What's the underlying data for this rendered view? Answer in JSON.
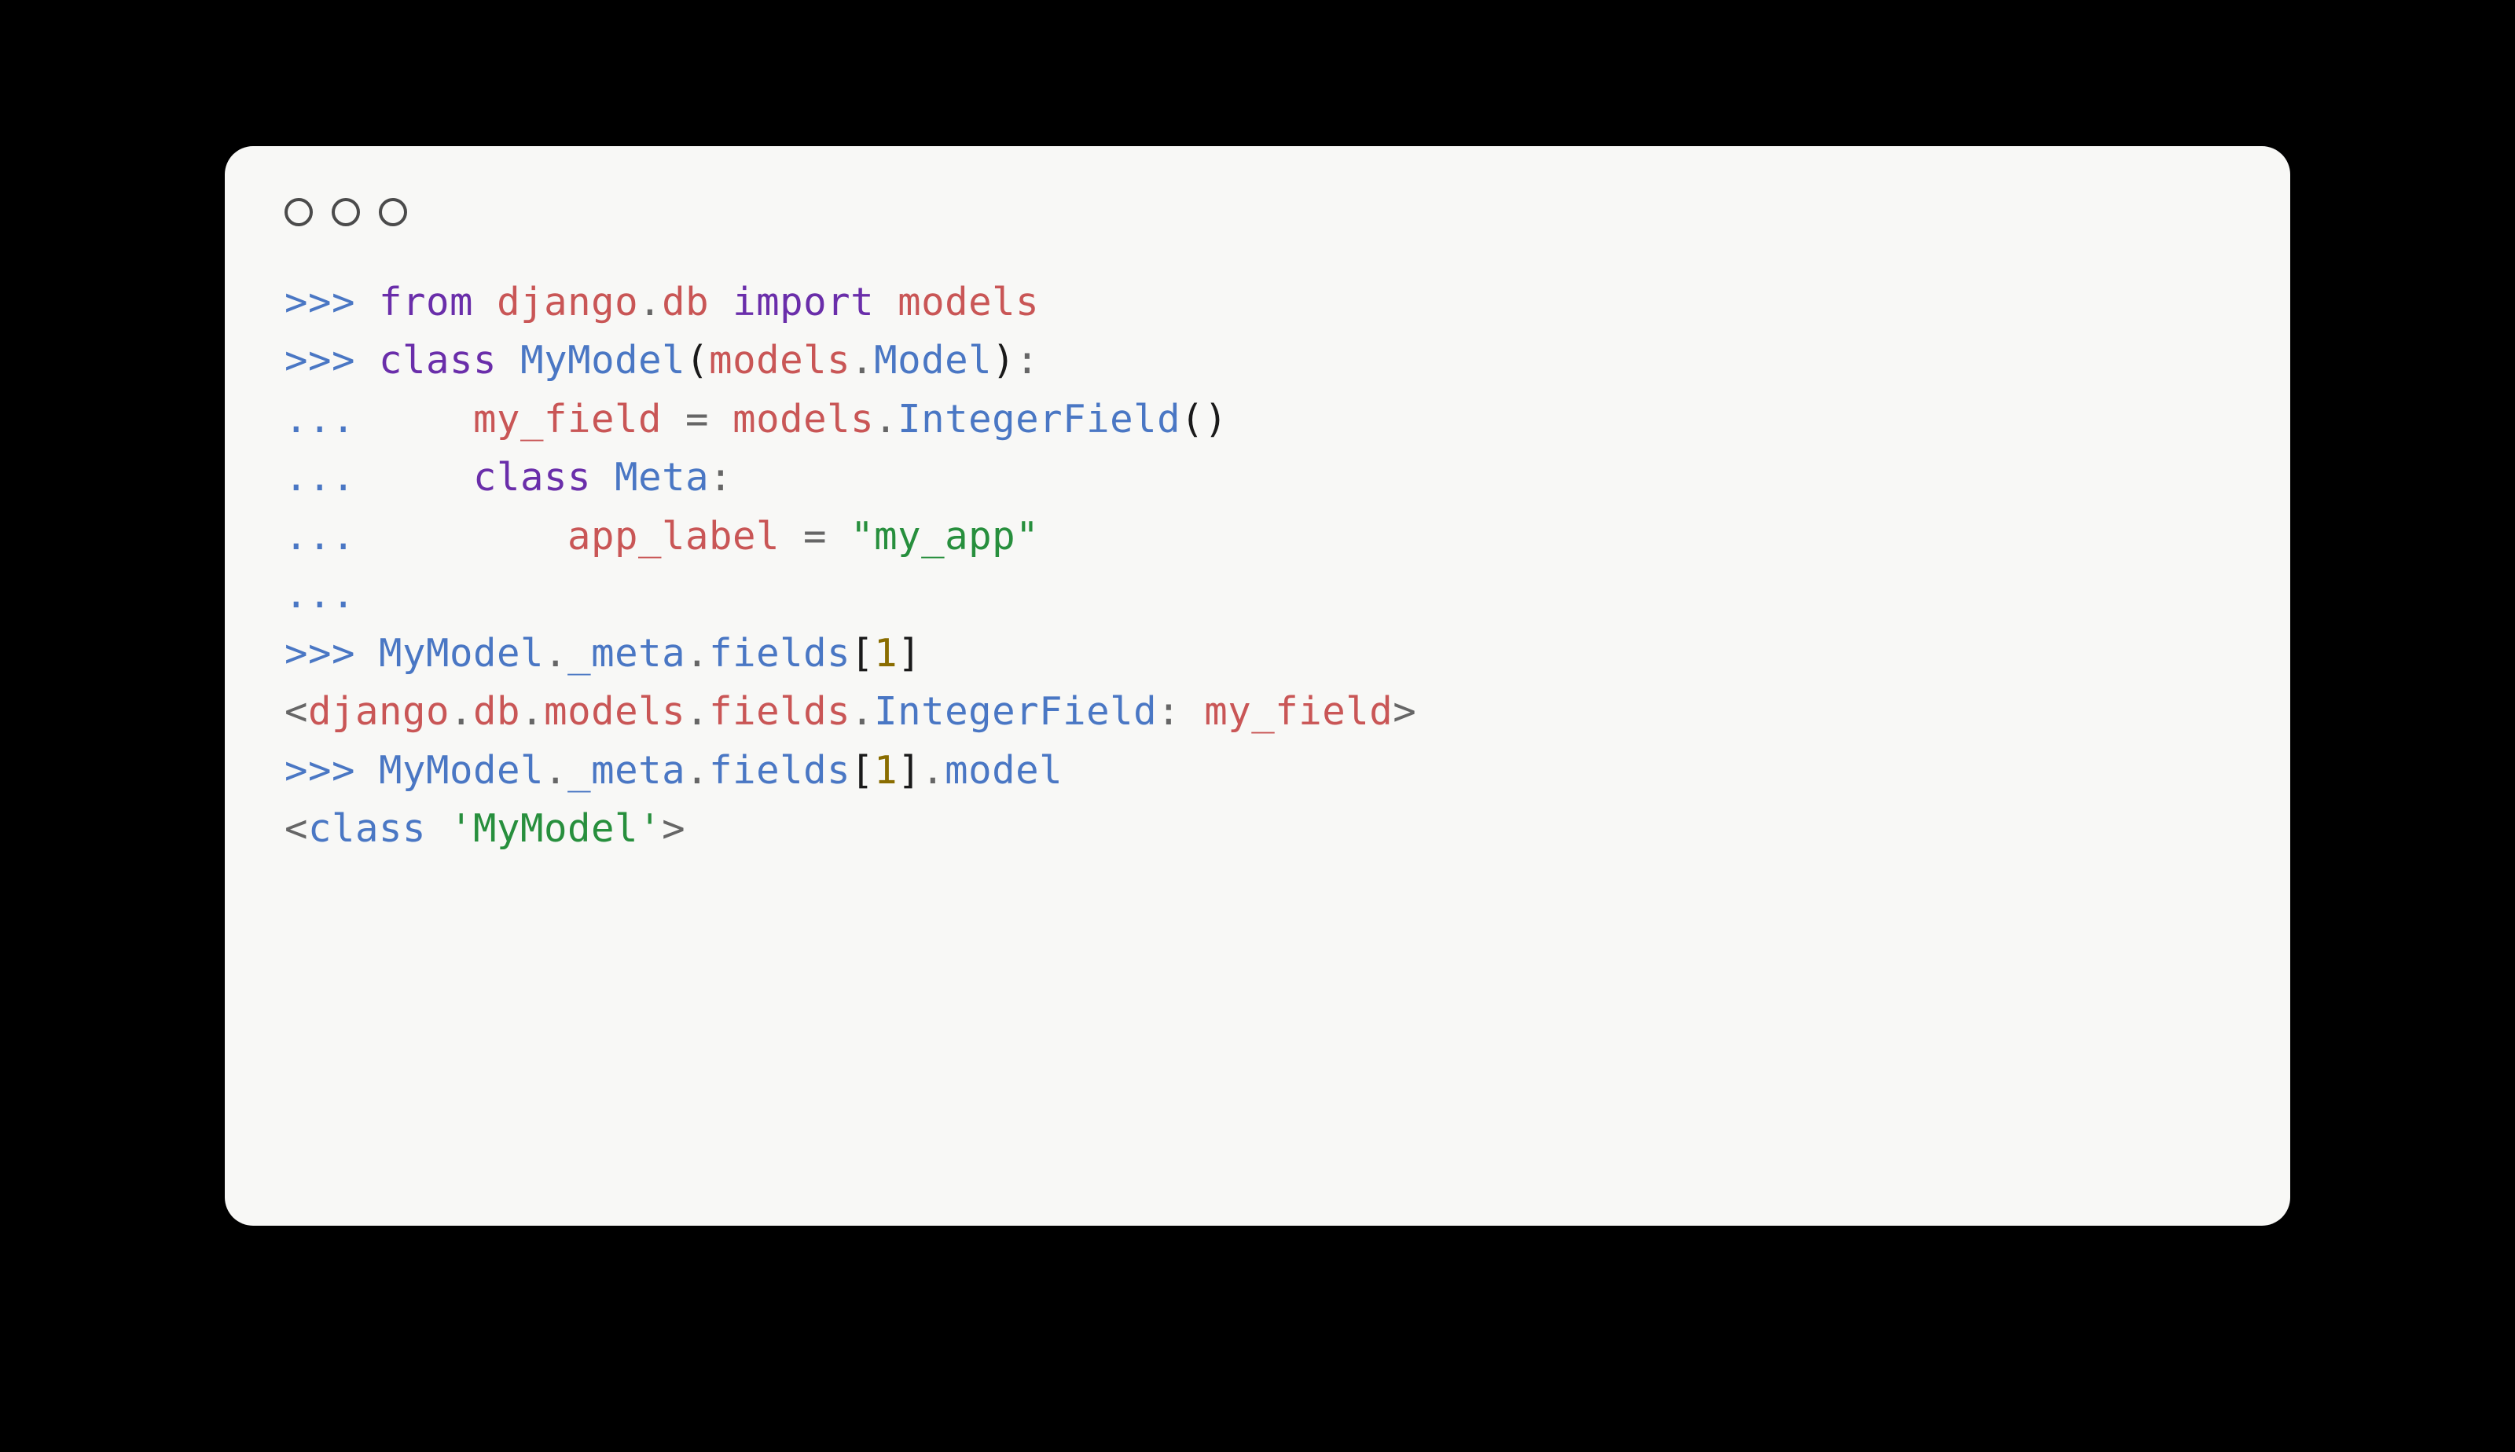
{
  "code": {
    "l1": {
      "prompt": ">>>",
      "kw1": "from",
      "mod1": "django",
      "mod2": "db",
      "kw2": "import",
      "mod3": "models"
    },
    "l2": {
      "prompt": ">>>",
      "kw": "class",
      "name": "MyModel",
      "lpar": "(",
      "base1": "models",
      "dot": ".",
      "base2": "Model",
      "rpar": ")",
      "colon": ":"
    },
    "l3": {
      "prompt": "...",
      "indent": "     ",
      "lhs": "my_field",
      "eq": " = ",
      "mod": "models",
      "dot": ".",
      "call": "IntegerField",
      "paren": "()"
    },
    "l4": {
      "prompt": "...",
      "indent": "     ",
      "kw": "class",
      "name": "Meta",
      "colon": ":"
    },
    "l5": {
      "prompt": "...",
      "indent": "         ",
      "lhs": "app_label",
      "eq": " = ",
      "str": "\"my_app\""
    },
    "l6": {
      "prompt": "..."
    },
    "l7": {
      "prompt": ">>>",
      "obj": "MyModel",
      "dot1": ".",
      "attr1": "_meta",
      "dot2": ".",
      "attr2": "fields",
      "lbr": "[",
      "idx": "1",
      "rbr": "]"
    },
    "l8": {
      "lt": "<",
      "p1": "django",
      "p2": "db",
      "p3": "models",
      "p4": "fields",
      "p5": "IntegerField",
      "colon": ":",
      "name": "my_field",
      "gt": ">"
    },
    "l9": {
      "prompt": ">>>",
      "obj": "MyModel",
      "dot1": ".",
      "attr1": "_meta",
      "dot2": ".",
      "attr2": "fields",
      "lbr": "[",
      "idx": "1",
      "rbr": "]",
      "dot3": ".",
      "attr3": "model"
    },
    "l10": {
      "lt": "<",
      "cls": "class",
      "sp": " ",
      "str": "'MyModel'",
      "gt": ">"
    }
  }
}
